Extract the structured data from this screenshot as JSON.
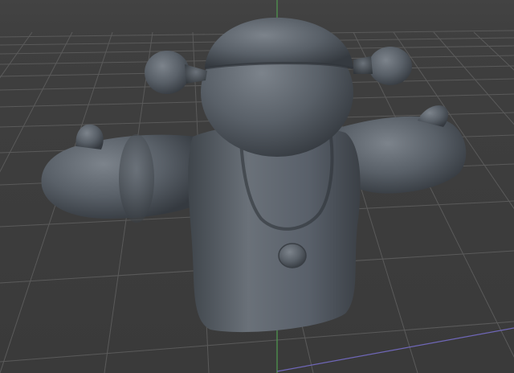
{
  "viewport": {
    "background_color": "#3a3a3a",
    "grid_color": "#5c5c5c",
    "y_axis_color": "#4f9a4f",
    "x_axis_color": "#6f67b8"
  },
  "model": {
    "type": "clay-sculpt",
    "material_color": "#5b6168",
    "shading": "smooth-gray"
  }
}
